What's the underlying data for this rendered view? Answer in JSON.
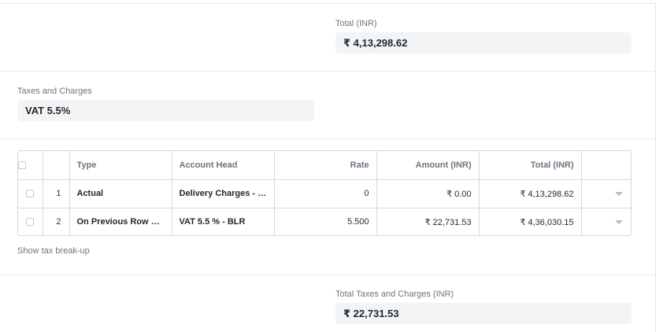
{
  "total": {
    "label": "Total (INR)",
    "value": "₹ 4,13,298.62"
  },
  "taxes_template": {
    "label": "Taxes and Charges",
    "value": "VAT 5.5%"
  },
  "taxes_table": {
    "columns": {
      "type": "Type",
      "account_head": "Account Head",
      "rate": "Rate",
      "amount": "Amount (INR)",
      "total": "Total (INR)"
    },
    "rows": [
      {
        "idx": "1",
        "type": "Actual",
        "account_head": "Delivery Charges - B...",
        "rate": "0",
        "amount": "₹ 0.00",
        "total": "₹ 4,13,298.62"
      },
      {
        "idx": "2",
        "type": "On Previous Row To...",
        "account_head": "VAT 5.5 % - BLR",
        "rate": "5.500",
        "amount": "₹ 22,731.53",
        "total": "₹ 4,36,030.15"
      }
    ]
  },
  "show_tax_breakup": "Show tax break-up",
  "total_taxes": {
    "label": "Total Taxes and Charges (INR)",
    "value": "₹ 22,731.53"
  }
}
